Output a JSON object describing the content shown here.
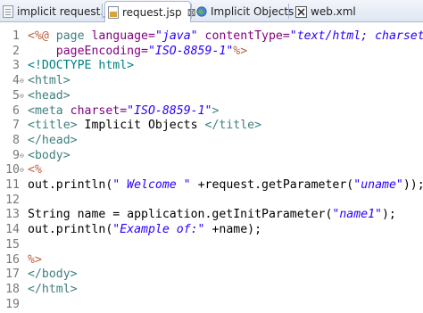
{
  "tabs": [
    {
      "label": "implicit request.jsp",
      "active": false,
      "closable": false,
      "icon": "file-icon"
    },
    {
      "label": "request.jsp",
      "active": true,
      "closable": true,
      "close_glyph": "⊠",
      "icon": "jsp-file-icon"
    },
    {
      "label": "Implicit Objects",
      "active": false,
      "closable": false,
      "icon": "browser-globe-icon"
    },
    {
      "label": "web.xml",
      "active": false,
      "closable": false,
      "icon": "xml-file-icon"
    }
  ],
  "editor": {
    "lines": [
      {
        "num": "1",
        "fold": "",
        "segments": [
          {
            "t": "<%@ ",
            "c": "c-jsp"
          },
          {
            "t": "page ",
            "c": "c-tag"
          },
          {
            "t": "language=",
            "c": "c-attr"
          },
          {
            "t": "\"java\"",
            "c": "c-str"
          },
          {
            "t": " contentType=",
            "c": "c-attr"
          },
          {
            "t": "\"text/html; charset=I",
            "c": "c-str"
          }
        ]
      },
      {
        "num": "2",
        "fold": "",
        "segments": [
          {
            "t": "    pageEncoding=",
            "c": "c-attr"
          },
          {
            "t": "\"ISO-8859-1\"",
            "c": "c-str"
          },
          {
            "t": "%>",
            "c": "c-jsp"
          }
        ]
      },
      {
        "num": "3",
        "fold": "",
        "segments": [
          {
            "t": "<!DOCTYPE html>",
            "c": "c-doc"
          }
        ]
      },
      {
        "num": "4",
        "fold": "⊖",
        "segments": [
          {
            "t": "<html>",
            "c": "c-tag"
          }
        ]
      },
      {
        "num": "5",
        "fold": "⊖",
        "segments": [
          {
            "t": "<head>",
            "c": "c-tag"
          }
        ]
      },
      {
        "num": "6",
        "fold": "",
        "segments": [
          {
            "t": "<meta ",
            "c": "c-tag"
          },
          {
            "t": "charset=",
            "c": "c-attr"
          },
          {
            "t": "\"ISO-8859-1\"",
            "c": "c-str"
          },
          {
            "t": ">",
            "c": "c-tag"
          }
        ]
      },
      {
        "num": "7",
        "fold": "",
        "segments": [
          {
            "t": "<title>",
            "c": "c-tag"
          },
          {
            "t": " Implicit Objects ",
            "c": "c-plain"
          },
          {
            "t": "</title>",
            "c": "c-tag"
          }
        ]
      },
      {
        "num": "8",
        "fold": "",
        "segments": [
          {
            "t": "</head>",
            "c": "c-tag"
          }
        ]
      },
      {
        "num": "9",
        "fold": "⊖",
        "segments": [
          {
            "t": "<body>",
            "c": "c-tag"
          }
        ]
      },
      {
        "num": "10",
        "fold": "⊖",
        "segments": [
          {
            "t": "<%",
            "c": "c-jsp"
          }
        ]
      },
      {
        "num": "11",
        "fold": "",
        "segments": [
          {
            "t": "out.println(",
            "c": "c-plain"
          },
          {
            "t": "\" Welcome \"",
            "c": "c-str"
          },
          {
            "t": " +request.getParameter(",
            "c": "c-plain"
          },
          {
            "t": "\"uname\"",
            "c": "c-str"
          },
          {
            "t": "));",
            "c": "c-plain"
          }
        ]
      },
      {
        "num": "12",
        "fold": "",
        "segments": []
      },
      {
        "num": "13",
        "fold": "",
        "segments": [
          {
            "t": "String name = application.getInitParameter(",
            "c": "c-plain"
          },
          {
            "t": "\"name1\"",
            "c": "c-str"
          },
          {
            "t": ");",
            "c": "c-plain"
          }
        ]
      },
      {
        "num": "14",
        "fold": "",
        "segments": [
          {
            "t": "out.println(",
            "c": "c-plain"
          },
          {
            "t": "\"Example of:\"",
            "c": "c-str"
          },
          {
            "t": " +name);",
            "c": "c-plain"
          }
        ]
      },
      {
        "num": "15",
        "fold": "",
        "segments": []
      },
      {
        "num": "16",
        "fold": "",
        "segments": [
          {
            "t": "%>",
            "c": "c-jsp"
          }
        ]
      },
      {
        "num": "17",
        "fold": "",
        "segments": [
          {
            "t": "</body>",
            "c": "c-tag"
          }
        ]
      },
      {
        "num": "18",
        "fold": "",
        "segments": [
          {
            "t": "</html>",
            "c": "c-tag"
          }
        ]
      },
      {
        "num": "19",
        "fold": "",
        "segments": []
      }
    ]
  },
  "colors": {
    "tag": "#3f7f7f",
    "attribute": "#7f007f",
    "string": "#2a00ff",
    "jsp_delimiter": "#bf5f3f",
    "line_number": "#787878"
  }
}
